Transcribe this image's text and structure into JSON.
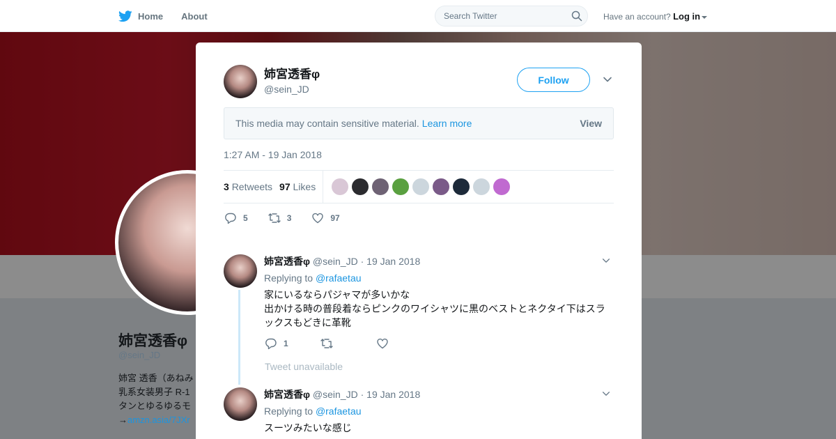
{
  "topbar": {
    "home_label": "Home",
    "about_label": "About",
    "search_placeholder": "Search Twitter",
    "have_account": "Have an account?",
    "login_label": "Log in"
  },
  "profile": {
    "name": "姉宮透香φ",
    "handle": "@sein_JD",
    "bio_lines": [
      "姉宮 透香（あねみ",
      "乳系女装男子 R-1",
      "タンとゆるゆるモ"
    ],
    "link_prefix": "→",
    "link_text": "amzn.asia/7JXr"
  },
  "tweet": {
    "name": "姉宮透香φ",
    "handle": "@sein_JD",
    "follow_label": "Follow",
    "sensitive_text": "This media may contain sensitive material.",
    "learn_more": "Learn more",
    "view_label": "View",
    "timestamp": "1:27 AM - 19 Jan 2018",
    "retweets_count": "3",
    "retweets_label": "Retweets",
    "likes_count": "97",
    "likes_label": "Likes",
    "reply_count": "5",
    "retweet_action_count": "3",
    "like_action_count": "97",
    "liker_colors": [
      "#d9c7d6",
      "#2b2b2f",
      "#6e6274",
      "#5aa040",
      "#ccd6dd",
      "#7a5a88",
      "#1d2a3a",
      "#ccd6dd",
      "#c06ad0"
    ]
  },
  "replies": [
    {
      "name": "姉宮透香φ",
      "handle": "@sein_JD",
      "dot": "·",
      "date": "19 Jan 2018",
      "replying_to": "Replying to",
      "mention": "@rafaetau",
      "text_lines": [
        "家にいるならパジャマが多いかな",
        "出かける時の普段着ならピンクのワイシャツに黒のベストとネクタイ下はスラ",
        "ックスもどきに革靴"
      ],
      "reply_count": "1",
      "retweet_count": "",
      "like_count": ""
    },
    {
      "name": "姉宮透香φ",
      "handle": "@sein_JD",
      "dot": "·",
      "date": "19 Jan 2018",
      "replying_to": "Replying to",
      "mention": "@rafaetau",
      "text_lines": [
        "スーツみたいな感じ"
      ]
    }
  ],
  "unavailable_text": "Tweet unavailable",
  "colors": {
    "brand_blue": "#1da1f2",
    "link_blue": "#1b95e0",
    "muted": "#657786",
    "thread_line": "#cce8f9"
  }
}
